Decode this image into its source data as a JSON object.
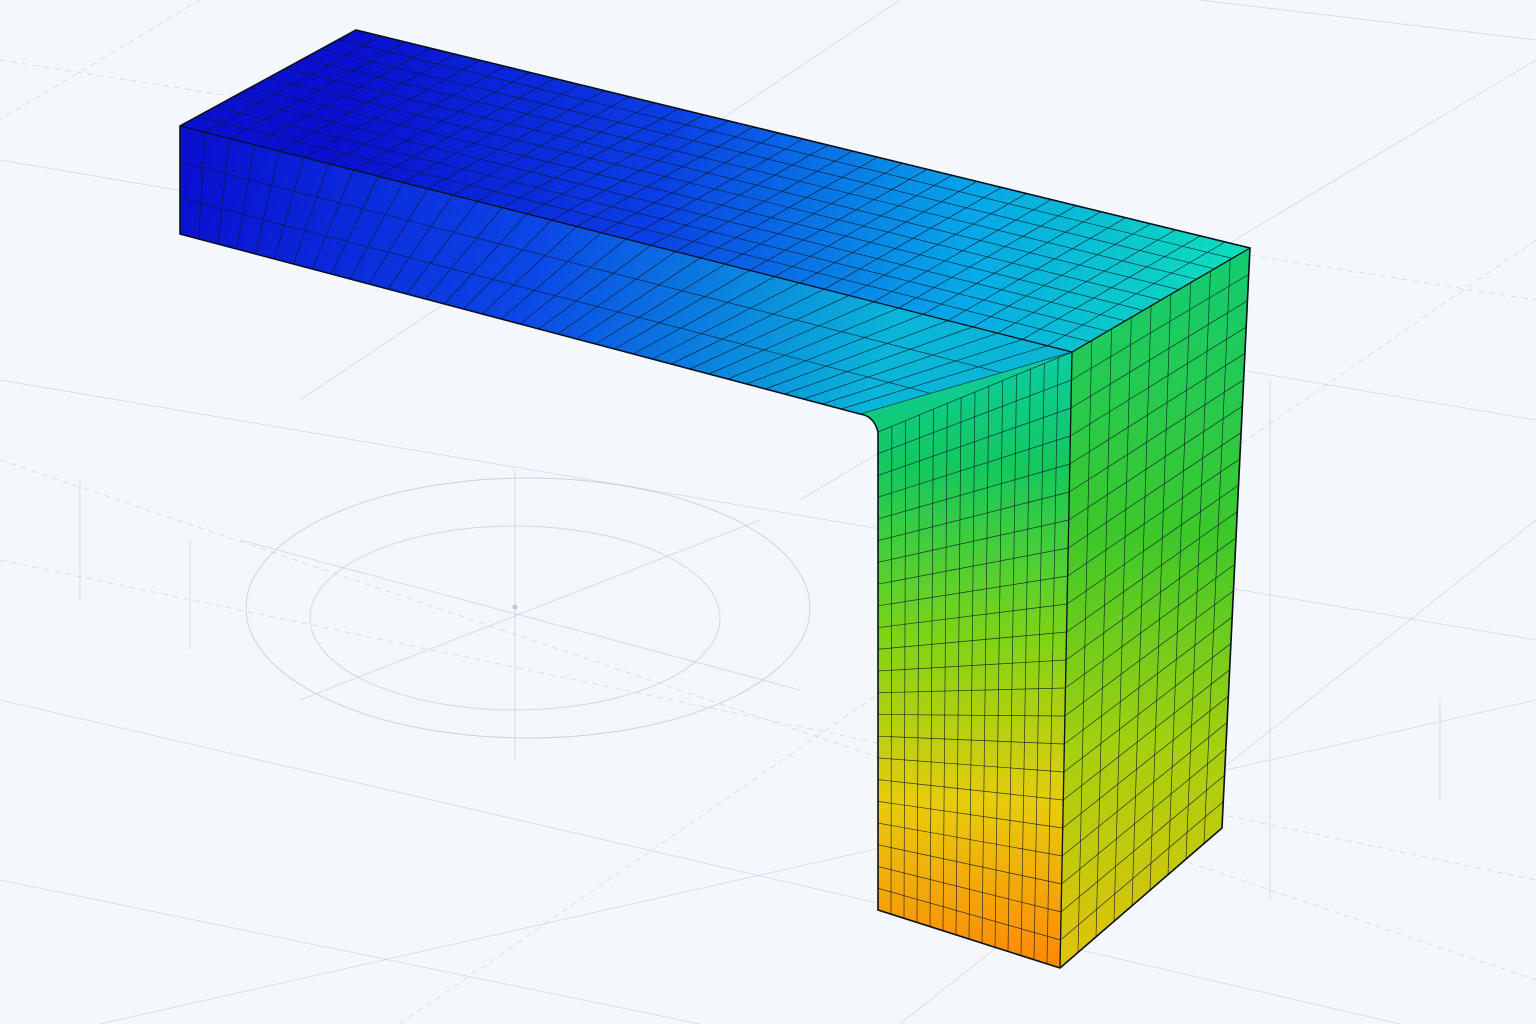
{
  "scene": {
    "background": "#f4f8fc",
    "construction_line_color": "#9fb8d2",
    "mesh_line_color": "#0c1a2a",
    "colormap": [
      "#0a0fd6",
      "#0c3fe6",
      "#0a8be8",
      "#06d6d8",
      "#12cc66",
      "#5fd21a",
      "#c8d80c",
      "#f6c60c",
      "#ff8a06"
    ],
    "mesh": {
      "top_columns": 36,
      "top_rows": 10,
      "front_columns": 36,
      "front_rows": 3,
      "leg_columns": 14,
      "leg_rows": 22,
      "side_columns": 9,
      "side_rows": 22
    }
  }
}
